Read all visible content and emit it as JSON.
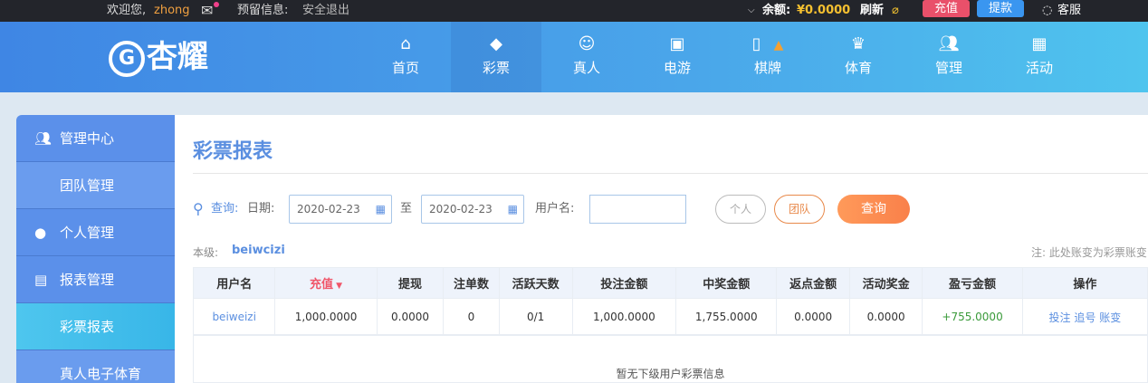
{
  "topbar": {
    "welcome": "欢迎您,",
    "username": "zhong",
    "message_label": "预留信息:",
    "logout": "安全退出",
    "balance_label": "余额:",
    "balance": "¥0.0000",
    "refresh": "刷新",
    "deposit": "充值",
    "withdraw": "提款",
    "service": "客服"
  },
  "logo": "杏耀",
  "nav": [
    {
      "label": "首页",
      "icon": "home-icon"
    },
    {
      "label": "彩票",
      "icon": "lottery-icon"
    },
    {
      "label": "真人",
      "icon": "live-dealer-icon"
    },
    {
      "label": "电游",
      "icon": "slot-machine-icon"
    },
    {
      "label": "棋牌",
      "icon": "cards-icon"
    },
    {
      "label": "体育",
      "icon": "trophy-icon"
    },
    {
      "label": "管理",
      "icon": "users-icon"
    },
    {
      "label": "活动",
      "icon": "gift-icon"
    }
  ],
  "sidebar": [
    {
      "label": "管理中心"
    },
    {
      "label": "团队管理"
    },
    {
      "label": "个人管理"
    },
    {
      "label": "报表管理"
    },
    {
      "label": "彩票报表"
    },
    {
      "label": "真人电子体育"
    }
  ],
  "page": {
    "title": "彩票报表",
    "query_label": "查询:",
    "date_label": "日期:",
    "date_from": "2020-02-23",
    "to": "至",
    "date_to": "2020-02-23",
    "username_label": "用户名:",
    "username_value": "",
    "personal": "个人",
    "team": "团队",
    "search": "查询",
    "level_label": "本级:",
    "level_user": "beiwcizi",
    "note": "注: 此处账变为彩票账变"
  },
  "table": {
    "headers": [
      "用户名",
      "充值",
      "提现",
      "注单数",
      "活跃天数",
      "投注金额",
      "中奖金额",
      "返点金额",
      "活动奖金",
      "盈亏金额",
      "操作"
    ],
    "rows": [
      {
        "cells": [
          "beiweizi",
          "1,000.0000",
          "0.0000",
          "0",
          "0/1",
          "1,000.0000",
          "1,755.0000",
          "0.0000",
          "0.0000",
          "+755.0000"
        ],
        "actions": [
          "投注",
          "追号",
          "账变"
        ]
      }
    ],
    "empty": "暂无下级用户彩票信息"
  },
  "colors": {
    "accent": "#5b8fe0",
    "profit": "#3a9a3a",
    "sort_active": "#f0566a"
  }
}
